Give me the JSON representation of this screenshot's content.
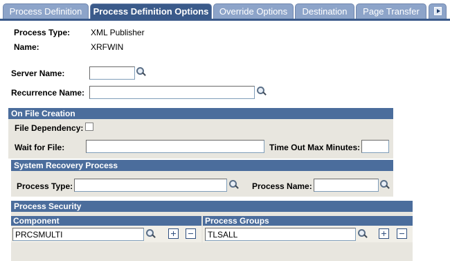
{
  "tabs": [
    {
      "label": "Process Definition",
      "active": false
    },
    {
      "label": "Process Definition Options",
      "active": true
    },
    {
      "label": "Override Options",
      "active": false
    },
    {
      "label": "Destination",
      "active": false
    },
    {
      "label": "Page Transfer",
      "active": false
    }
  ],
  "header": {
    "process_type_label": "Process Type:",
    "process_type_value": "XML Publisher",
    "name_label": "Name:",
    "name_value": "XRFWIN"
  },
  "fields": {
    "server_name_label": "Server Name:",
    "server_name_value": "",
    "recurrence_name_label": "Recurrence Name:",
    "recurrence_name_value": ""
  },
  "on_file_creation": {
    "title": "On File Creation",
    "file_dependency_label": "File Dependency:",
    "file_dependency_checked": false,
    "wait_for_file_label": "Wait for File:",
    "wait_for_file_value": "",
    "timeout_label": "Time Out Max Minutes:",
    "timeout_value": ""
  },
  "system_recovery": {
    "title": "System Recovery Process",
    "process_type_label": "Process Type:",
    "process_type_value": "",
    "process_name_label": "Process Name:",
    "process_name_value": ""
  },
  "process_security": {
    "title": "Process Security",
    "component_header": "Component",
    "component_value": "PRCSMULTI",
    "groups_header": "Process Groups",
    "groups_value": "TLSALL"
  },
  "colors": {
    "tab_active": "#3a5a8a",
    "tab_inactive": "#8da4c9",
    "section_bar": "#4b6d9c",
    "panel_bg": "#e8e6df"
  },
  "icons": [
    "lookup-icon",
    "add-row-icon",
    "delete-row-icon",
    "next-tab-icon"
  ]
}
